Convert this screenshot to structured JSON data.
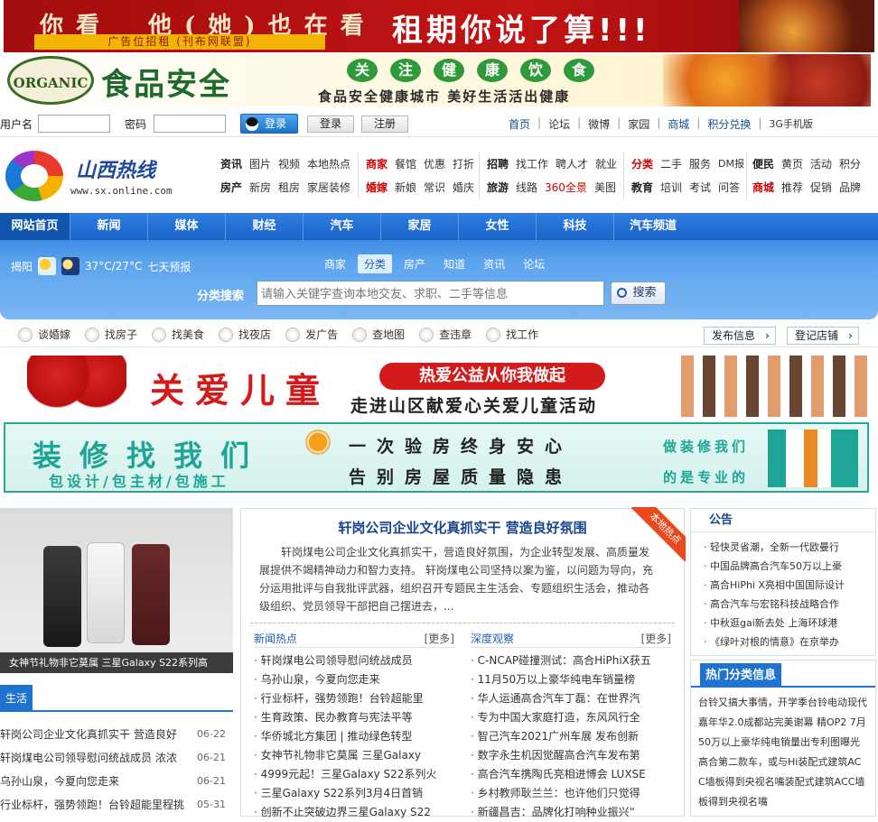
{
  "banner1": {
    "text_left": "你看　他(她)也在看",
    "sub": "广告位招租 (刊布网联盟)",
    "text_right": "租期你说了算!!!"
  },
  "banner2": {
    "brand": "ORGANIC",
    "title": "食品安全",
    "circles": [
      "关",
      "注",
      "健",
      "康",
      "饮",
      "食"
    ],
    "slogan": "食品安全健康城市 美好生活活出健康"
  },
  "login": {
    "user_label": "用户名",
    "pwd_label": "密码",
    "qq_btn": "登录",
    "login_btn": "登录",
    "register_btn": "注册"
  },
  "topnav": [
    "首页",
    "论坛",
    "微博",
    "家园",
    "商城",
    "积分兑换",
    "3G手机版"
  ],
  "logo": {
    "title": "山西热线",
    "url": "www.sx.online.com"
  },
  "catgrid": {
    "g1": [
      [
        "资讯",
        "图片",
        "视频",
        "本地热点"
      ],
      [
        "房产",
        "新房",
        "租房",
        "家居装修"
      ]
    ],
    "g2": [
      [
        "商家",
        "餐馆",
        "优惠",
        "打折"
      ],
      [
        "婚嫁",
        "新娘",
        "常识",
        "婚庆"
      ]
    ],
    "g3": [
      [
        "招聘",
        "找工作",
        "聘人才",
        "就业"
      ],
      [
        "旅游",
        "线路",
        "360全景",
        "美图"
      ]
    ],
    "g4": [
      [
        "分类",
        "二手",
        "服务",
        "DM报"
      ],
      [
        "教育",
        "培训",
        "考试",
        "问答"
      ]
    ],
    "g5": [
      [
        "便民",
        "黄页",
        "活动",
        "积分"
      ],
      [
        "商城",
        "推荐",
        "促销",
        "品牌"
      ]
    ]
  },
  "mainnav": [
    "网站首页",
    "新闻",
    "媒体",
    "财经",
    "汽车",
    "家居",
    "女性",
    "科技",
    "汽车频道"
  ],
  "weather": {
    "city": "揭阳",
    "temp": "37°C/27°C",
    "forecast": "七天预报"
  },
  "search": {
    "tabs": [
      "商家",
      "分类",
      "房产",
      "知道",
      "资讯",
      "论坛"
    ],
    "label": "分类搜索",
    "placeholder": "请输入关键字查询本地交友、求职、二手等信息",
    "button": "搜索"
  },
  "quick": {
    "items": [
      "谈婚嫁",
      "找房子",
      "找美食",
      "找夜店",
      "发广告",
      "查地图",
      "查违章",
      "找工作"
    ],
    "publish": "发布信息",
    "register_shop": "登记店铺"
  },
  "banner3": {
    "title": "关爱儿童",
    "pill": "热爱公益从你我做起",
    "sub": "走进山区献爱心关爱儿童活动"
  },
  "banner4": {
    "t1": "装修找我们",
    "t2": "包设计/包主材/包施工",
    "t3": "一次验房终身安心",
    "t4": "告别房屋质量隐患",
    "t5": "做装修我们",
    "t6": "的是专业的"
  },
  "left": {
    "caption": "女神节礼物非它莫属 三星Galaxy S22系列高",
    "tab": "生活",
    "items": [
      {
        "title": "轩岗公司企业文化真抓实干 营造良好",
        "date": "06-22"
      },
      {
        "title": "轩岗煤电公司领导慰问统战成员 浓浓",
        "date": "06-21"
      },
      {
        "title": "乌孙山泉，今夏向您走来",
        "date": "06-21"
      },
      {
        "title": "行业标杆，强势领跑！台铃超能里程挑",
        "date": "05-31"
      }
    ]
  },
  "center": {
    "title": "轩岗公司企业文化真抓实干 营造良好氛围",
    "ribbon": "本地热点",
    "summary": "轩岗煤电公司企业文化真抓实干，营造良好氛围，为企业转型发展、高质量发展提供不竭精神动力和智力支持。 轩岗煤电公司坚持以案为鉴，以问题为导向，充分运用批评与自我批评武器，组织召开专题民主生活会、专题组织生活会，推动各级组织、党员领导干部把自己摆进去，...",
    "news_hot": {
      "label": "新闻热点",
      "more": "[更多]",
      "items": [
        "轩岗煤电公司领导慰问统战成员",
        "乌孙山泉，今夏向您走来",
        "行业标杆，强势领跑！台铃超能里",
        "生育政策、民办教育与宪法平等",
        "华侨城北方集团 | 推动绿色转型",
        "女神节礼物非它莫属 三星Galaxy",
        "4999元起！三星Galaxy S22系列火",
        "三星Galaxy S22系列3月4日首销",
        "创新不止突破边界三星Galaxy S22"
      ]
    },
    "deep": {
      "label": "深度观察",
      "more": "[更多]",
      "items": [
        "C-NCAP碰撞测试：高合HiPhiX获五",
        "11月50万以上豪华纯电车销量榜",
        "华人运通高合汽车丁磊：在世界汽",
        "专为中国大家庭打造，东风风行全",
        "智己汽车2021广州车展 发布创新",
        "数字永生机因觉醒高合汽车发布第",
        "高合汽车携陶氏亮相进博会 LUXSE",
        "乡村教师耿兰兰：也许他们只觉得",
        "新疆昌吉：品牌化打响种业振兴“"
      ]
    }
  },
  "right": {
    "notice_title": "公告",
    "notices": [
      "轻快灵省潮，全新一代欧曼行",
      "中国品牌高合汽车50万以上豪",
      "高合HiPhi X亮相中国国际设计",
      "高合汽车与宏铭科技战略合作",
      "中秋逛gai新去处 上海环球港",
      "《绿叶对根的情意》在京举办"
    ],
    "hot_title": "热门分类信息",
    "hot_text": "台铃又搞大事情，开学季台铃电动现代嘉年华2.0成都站完美谢幕 精OP2 7月50万以上豪华纯电销量出专利图曝光高合第二款车，或与Hi装配式建筑ACC墙板得到央视名嘴装配式建筑ACC墙板得到央视名嘴"
  }
}
